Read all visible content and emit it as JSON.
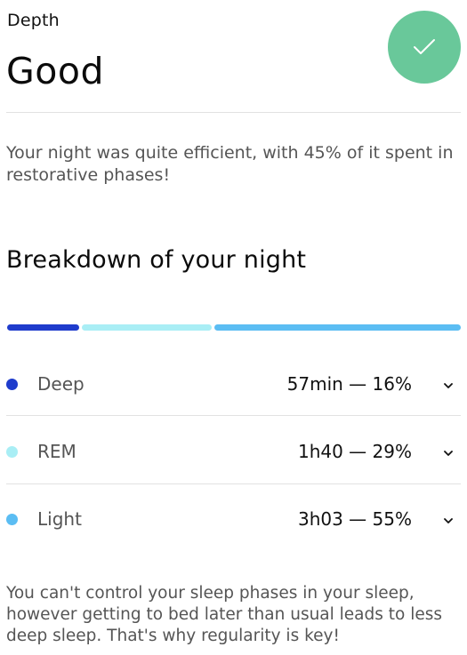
{
  "header": {
    "kicker": "Depth",
    "rating": "Good",
    "badge_icon": "check-icon",
    "badge_color": "#69c89a"
  },
  "summary": "Your night was quite efficient, with 45% of it spent in restorative phases!",
  "breakdown": {
    "title": "Breakdown of your night",
    "phases": [
      {
        "name": "Deep",
        "value": "57min — 16%",
        "percent": 16,
        "color": "#1f3ccc",
        "icon": "chevron-down-icon"
      },
      {
        "name": "REM",
        "value": "1h40 — 29%",
        "percent": 29,
        "color": "#a9eef5",
        "icon": "chevron-down-icon"
      },
      {
        "name": "Light",
        "value": "3h03 — 55%",
        "percent": 55,
        "color": "#5bbdf3",
        "icon": "chevron-down-icon"
      }
    ]
  },
  "footer_note": "You can't control your sleep phases in your sleep, however getting to bed later than usual leads to less deep sleep. That's why regularity is key!"
}
